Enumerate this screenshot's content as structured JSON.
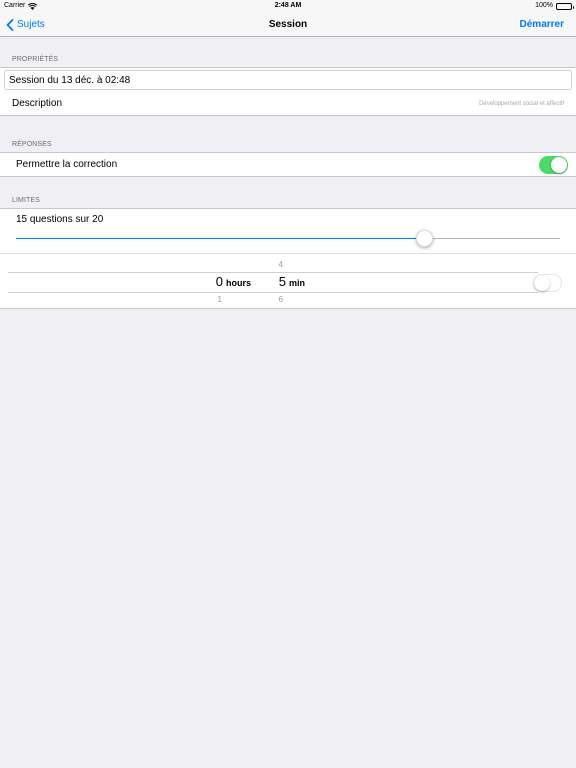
{
  "status_bar": {
    "carrier": "Carrier",
    "time": "2:48 AM",
    "battery": "100%"
  },
  "nav": {
    "back_label": "Sujets",
    "title": "Session",
    "action_label": "Démarrer"
  },
  "properties": {
    "header": "PROPRIÉTÉS",
    "title_value": "Session du 13 déc. à 02:48",
    "description_label": "Description",
    "description_value": "Développement social et affectif"
  },
  "responses": {
    "header": "RÉPONSES",
    "correction_label": "Permettre la correction",
    "correction_enabled": true
  },
  "limits": {
    "header": "LIMITES",
    "questions_label": "15 questions sur 20",
    "questions_selected": 15,
    "questions_total": 20,
    "timer": {
      "hours_value": "0",
      "hours_below": "1",
      "hours_unit": "hours",
      "min_above": "4",
      "min_value": "5",
      "min_below": "6",
      "min_unit": "min",
      "enabled": false
    }
  },
  "colors": {
    "accent": "#007aff",
    "toggle_on": "#4cd964",
    "background": "#efeff4",
    "section_header": "#6d6d72"
  }
}
